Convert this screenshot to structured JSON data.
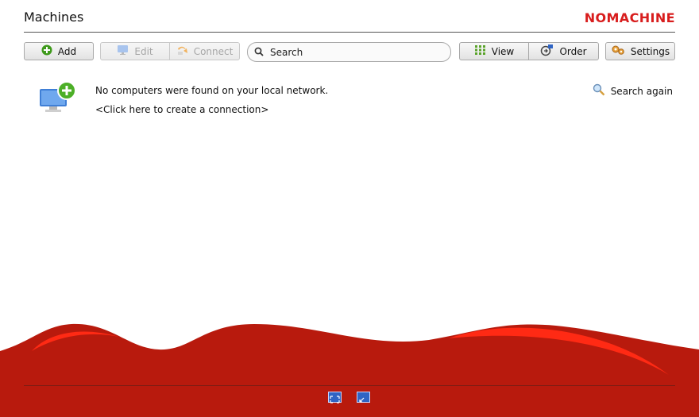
{
  "header": {
    "title": "Machines",
    "logo_text": "NOMACHINE"
  },
  "toolbar": {
    "add_label": "Add",
    "edit_label": "Edit",
    "connect_label": "Connect",
    "search_placeholder": "Search",
    "view_label": "View",
    "order_label": "Order",
    "settings_label": "Settings"
  },
  "main": {
    "empty_message": "No computers were found on your local network.",
    "create_link": "<Click here to create a connection>",
    "search_again_label": "Search again"
  },
  "colors": {
    "brand": "#d81d1d",
    "footer": "#b81a0d",
    "accent_green": "#3f9a1c"
  },
  "icons": {
    "add": "plus-circle-icon",
    "edit": "monitor-icon",
    "connect": "connect-arrow-icon",
    "search": "search-icon",
    "view": "grid-icon",
    "order": "order-icon",
    "settings": "gears-icon",
    "new_connection": "computer-add-icon",
    "search_again": "magnifier-icon",
    "fullscreen": "fullscreen-icon",
    "restore": "restore-icon"
  }
}
